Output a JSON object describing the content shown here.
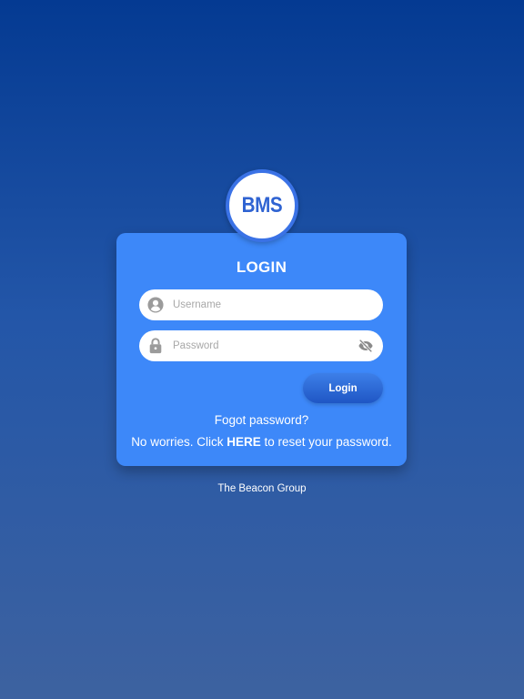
{
  "logo": {
    "text": "BMS"
  },
  "login_card": {
    "title": "LOGIN",
    "username": {
      "placeholder": "Username",
      "value": "",
      "icon": "user-circle-icon"
    },
    "password": {
      "placeholder": "Password",
      "value": "",
      "icon": "lock-icon",
      "toggle_icon": "eye-off-icon"
    },
    "login_button_label": "Login",
    "forgot_text": "Fogot password?",
    "reset": {
      "prefix": "No worries. Click ",
      "link_text": "HERE",
      "suffix": " to reset your password."
    }
  },
  "footer": {
    "text": "The Beacon Group"
  },
  "colors": {
    "background_top": "#043a92",
    "background_bottom": "#3d62a0",
    "card": "#3d88f9",
    "logo_text": "#2f63d2",
    "logo_ring": "#3a72e6",
    "button": "#1f56c4",
    "icon_gray": "#9b9b9b"
  }
}
